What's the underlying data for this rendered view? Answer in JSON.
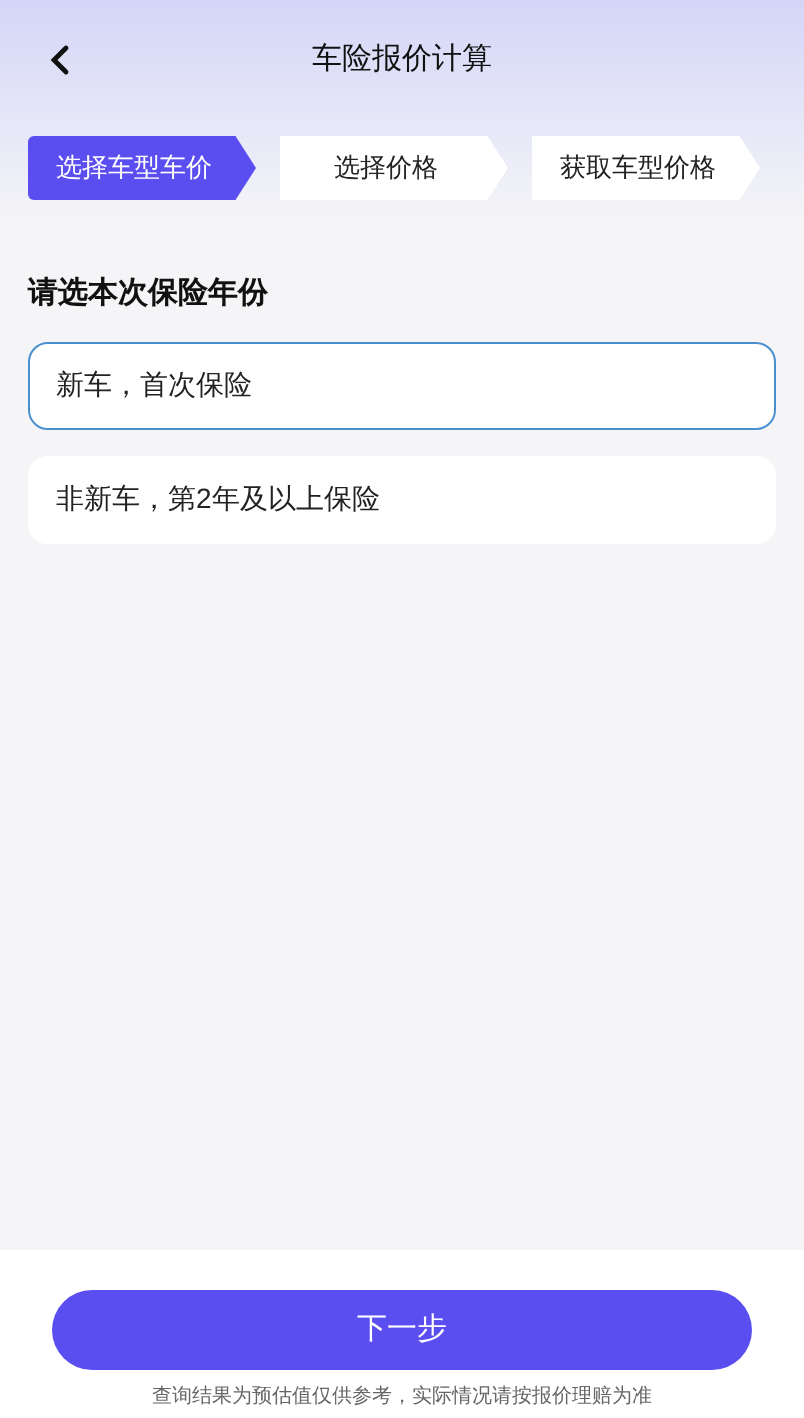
{
  "header": {
    "title": "车险报价计算"
  },
  "steps": [
    {
      "label": "选择车型车价",
      "selected": true
    },
    {
      "label": "选择价格",
      "selected": false
    },
    {
      "label": "获取车型价格",
      "selected": false
    }
  ],
  "section_title": "请选本次保险年份",
  "options": [
    {
      "label": "新车，首次保险",
      "selected": true
    },
    {
      "label": "非新车，第2年及以上保险",
      "selected": false
    }
  ],
  "next_button": "下一步",
  "disclaimer": "查询结果为预估值仅供参考，实际情况请按报价理赔为准"
}
